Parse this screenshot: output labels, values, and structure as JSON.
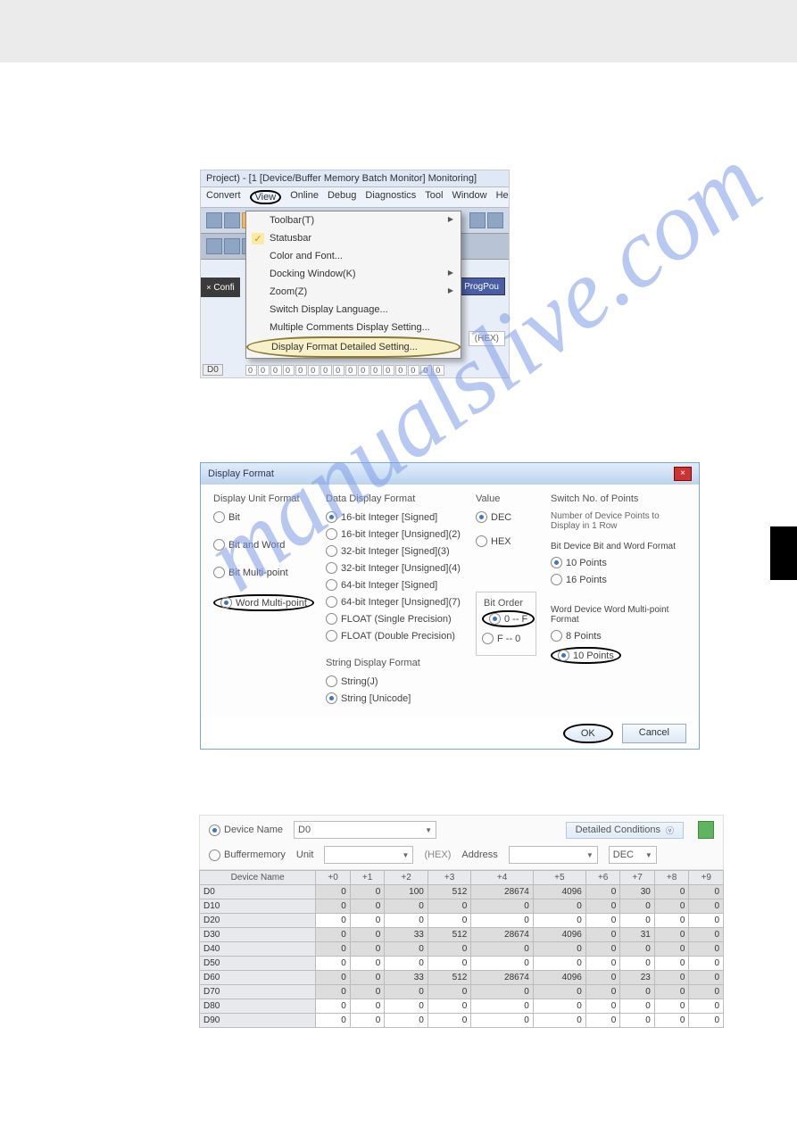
{
  "watermark": "manualslive.com",
  "fig1": {
    "titlebar": "Project) - [1 [Device/Buffer Memory Batch Monitor] Monitoring]",
    "menu": {
      "convert": "Convert",
      "view": "View",
      "online": "Online",
      "debug": "Debug",
      "diagnostics": "Diagnostics",
      "tool": "Tool",
      "window": "Window",
      "help": "Hel"
    },
    "sidebar_tab": "Confi",
    "prog_btn": "ProgPou",
    "hex": "(HEX)",
    "dropdown": {
      "items": [
        {
          "k": "toolbar",
          "label": "Toolbar(T)",
          "arrow": true
        },
        {
          "k": "statusbar",
          "label": "Statusbar",
          "checked": true
        },
        {
          "k": "colorfont",
          "label": "Color and Font..."
        },
        {
          "k": "docking",
          "label": "Docking Window(K)",
          "arrow": true
        },
        {
          "k": "zoom",
          "label": "Zoom(Z)",
          "arrow": true
        },
        {
          "k": "lang",
          "label": "Switch Display Language..."
        },
        {
          "k": "multcom",
          "label": "Multiple Comments Display Setting..."
        },
        {
          "k": "dfds",
          "label": "Display Format Detailed Setting...",
          "highlighted": true
        }
      ]
    },
    "d0": "D0",
    "bits": [
      "0",
      "0",
      "0",
      "0",
      "0",
      "0",
      "0",
      "0",
      "0",
      "0",
      "0",
      "0",
      "0",
      "0",
      "0",
      "0"
    ]
  },
  "fig2": {
    "title": "Display Format",
    "unit_format": {
      "title": "Display Unit Format",
      "opts": [
        "Bit",
        "Bit and Word",
        "Bit Multi-point",
        "Word Multi-point"
      ],
      "sel": 3,
      "circled": 3
    },
    "data_format": {
      "title": "Data Display Format",
      "opts": [
        "16-bit Integer [Signed]",
        "16-bit Integer [Unsigned](2)",
        "32-bit Integer [Signed](3)",
        "32-bit Integer [Unsigned](4)",
        "64-bit Integer [Signed]",
        "64-bit Integer [Unsigned](7)",
        "FLOAT (Single Precision)",
        "FLOAT (Double Precision)"
      ],
      "sel": 0
    },
    "string_format": {
      "title": "String Display Format",
      "opts": [
        "String(J)",
        "String [Unicode]"
      ],
      "sel": 1
    },
    "value": {
      "title": "Value",
      "opts": [
        "DEC",
        "HEX"
      ],
      "sel": 0
    },
    "bit_order": {
      "title": "Bit Order",
      "opts": [
        "0 -- F",
        "F -- 0"
      ],
      "sel": 0,
      "circled": 0
    },
    "switch": {
      "title": "Switch No. of Points",
      "sub": "Number of Device Points to Display in 1 Row",
      "bit_title": "Bit Device Bit and Word Format",
      "bit_opts": [
        "10 Points",
        "16 Points"
      ],
      "bit_sel": 0,
      "word_title": "Word Device Word Multi-point Format",
      "word_opts": [
        "8 Points",
        "10 Points"
      ],
      "word_sel": 1,
      "circled": 1
    },
    "ok": "OK",
    "cancel": "Cancel"
  },
  "fig3": {
    "device_name": "Device Name",
    "d0": "D0",
    "detailed": "Detailed Conditions",
    "buffer": "Buffermemory",
    "unit": "Unit",
    "hex": "(HEX)",
    "address": "Address",
    "dec": "DEC",
    "table": {
      "headers": [
        "Device Name",
        "+0",
        "+1",
        "+2",
        "+3",
        "+4",
        "+5",
        "+6",
        "+7",
        "+8",
        "+9"
      ],
      "rows": [
        {
          "name": "D0",
          "shaded": true,
          "v": [
            0,
            0,
            100,
            512,
            28674,
            4096,
            0,
            30,
            0,
            0
          ]
        },
        {
          "name": "D10",
          "shaded": true,
          "v": [
            0,
            0,
            0,
            0,
            0,
            0,
            0,
            0,
            0,
            0
          ]
        },
        {
          "name": "D20",
          "v": [
            0,
            0,
            0,
            0,
            0,
            0,
            0,
            0,
            0,
            0
          ]
        },
        {
          "name": "D30",
          "shaded": true,
          "v": [
            0,
            0,
            33,
            512,
            28674,
            4096,
            0,
            31,
            0,
            0
          ]
        },
        {
          "name": "D40",
          "shaded": true,
          "v": [
            0,
            0,
            0,
            0,
            0,
            0,
            0,
            0,
            0,
            0
          ]
        },
        {
          "name": "D50",
          "v": [
            0,
            0,
            0,
            0,
            0,
            0,
            0,
            0,
            0,
            0
          ]
        },
        {
          "name": "D60",
          "shaded": true,
          "v": [
            0,
            0,
            33,
            512,
            28674,
            4096,
            0,
            23,
            0,
            0
          ]
        },
        {
          "name": "D70",
          "shaded": true,
          "v": [
            0,
            0,
            0,
            0,
            0,
            0,
            0,
            0,
            0,
            0
          ]
        },
        {
          "name": "D80",
          "v": [
            0,
            0,
            0,
            0,
            0,
            0,
            0,
            0,
            0,
            0
          ]
        },
        {
          "name": "D90",
          "v": [
            0,
            0,
            0,
            0,
            0,
            0,
            0,
            0,
            0,
            0
          ]
        }
      ]
    }
  }
}
